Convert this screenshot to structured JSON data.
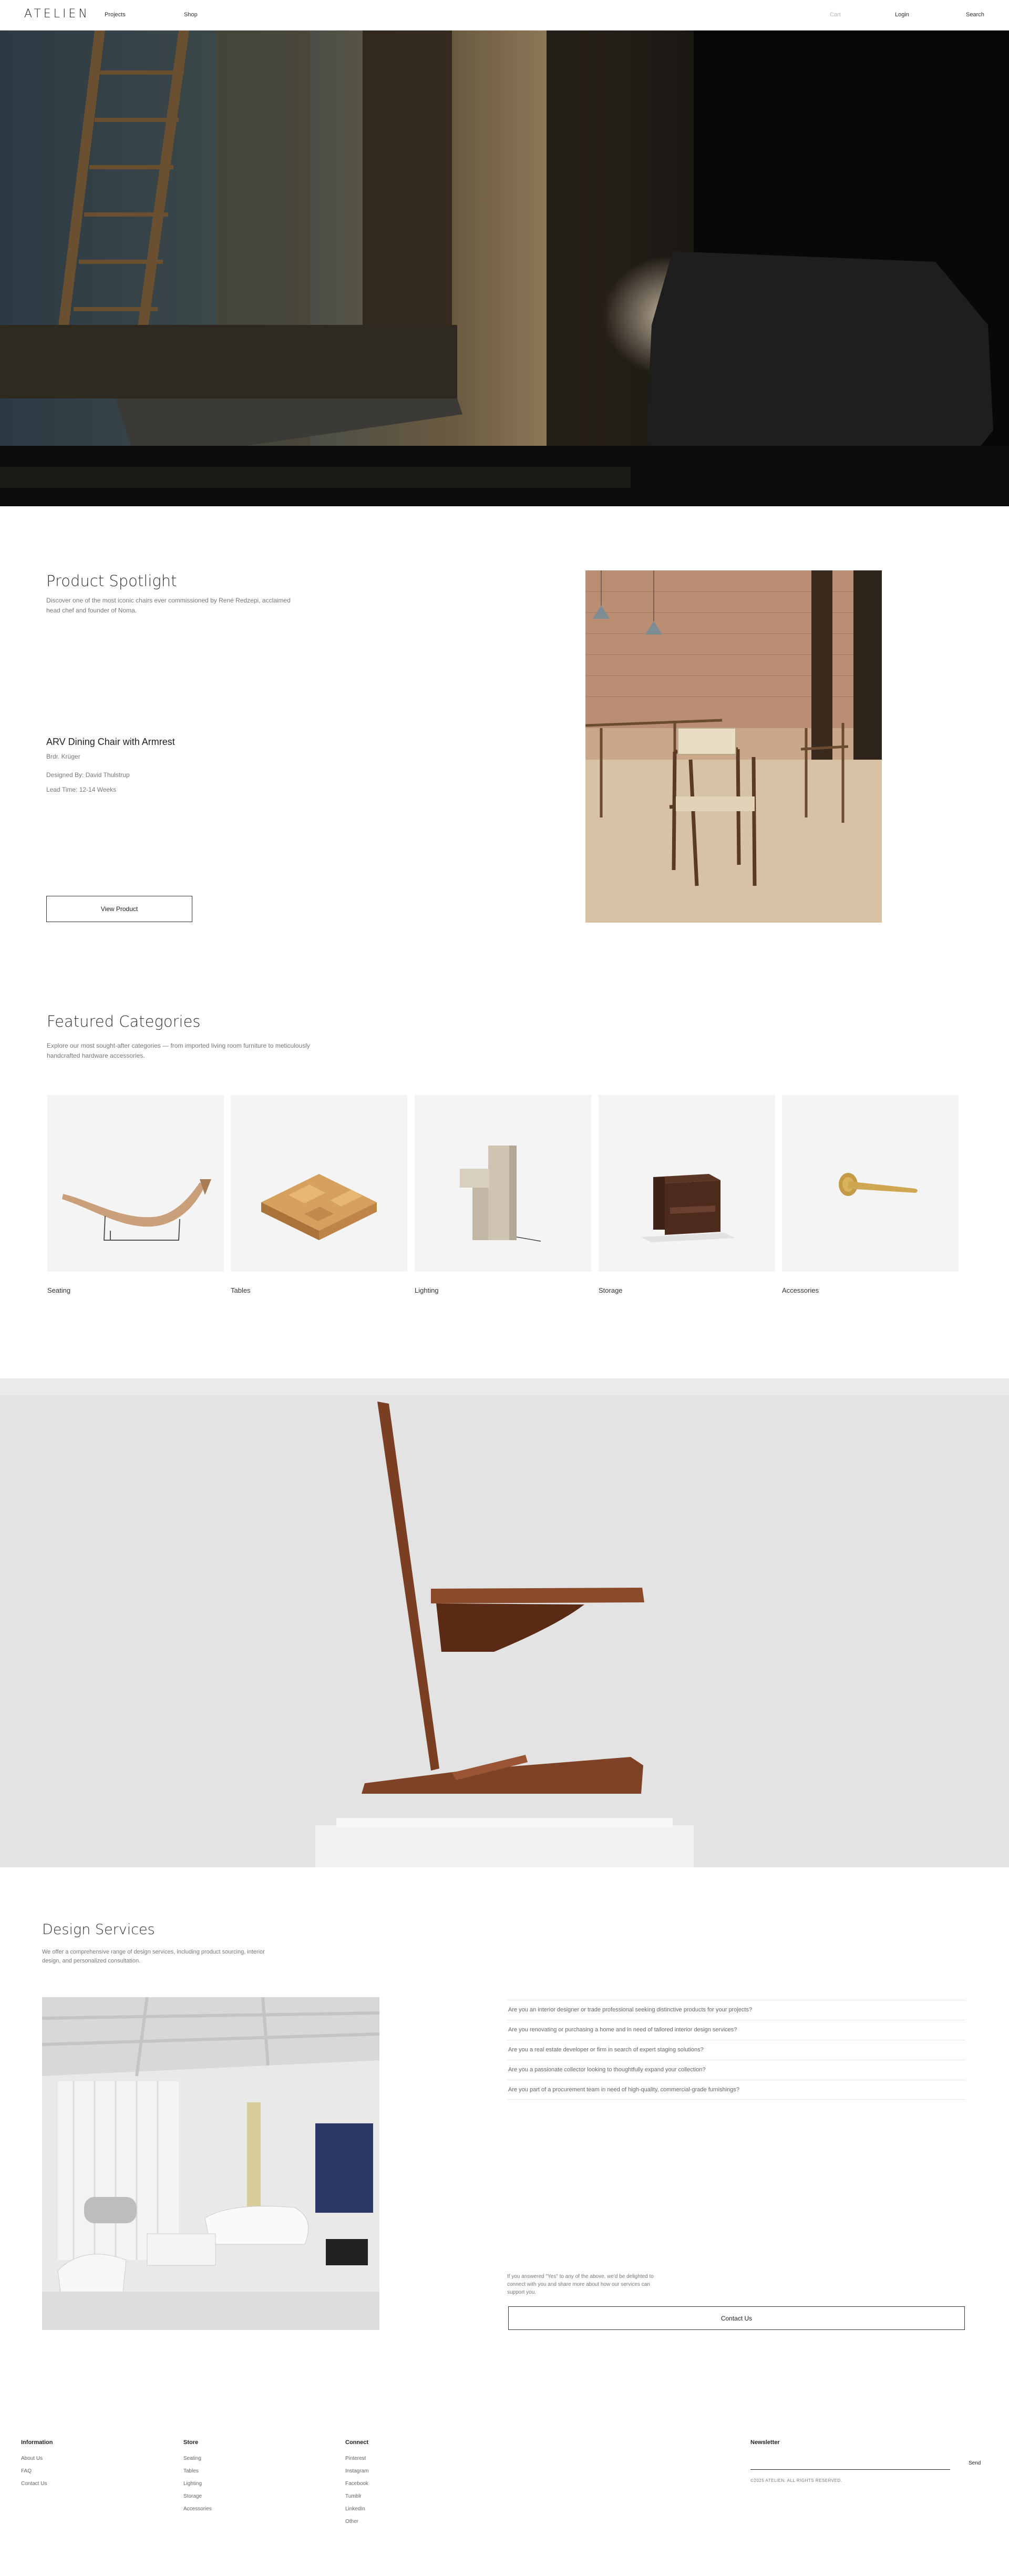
{
  "header": {
    "logo": "ATELIEN",
    "nav_projects": "Projects",
    "nav_shop": "Shop",
    "nav_cart": "Cart",
    "nav_login": "Login",
    "nav_search": "Search"
  },
  "spotlight": {
    "title": "Product Spotlight",
    "description": "Discover one of the most iconic chairs ever commissioned by René Redzepi, acclaimed head chef and founder of Noma.",
    "product_name": "ARV Dining Chair with Armrest",
    "brand": "Brdr. Krüger",
    "designer": "Designed By: David Thulstrup",
    "lead_time": "Lead Time: 12-14 Weeks",
    "button": "View Product"
  },
  "categories": {
    "title": "Featured Categories",
    "description": "Explore our most sought-after categories — from imported living room furniture to meticulously handcrafted hardware accessories.",
    "items": [
      {
        "label": "Seating",
        "icon": "lounge-chair-image"
      },
      {
        "label": "Tables",
        "icon": "table-image"
      },
      {
        "label": "Lighting",
        "icon": "lamp-image"
      },
      {
        "label": "Storage",
        "icon": "cabinet-image"
      },
      {
        "label": "Accessories",
        "icon": "door-handle-image"
      }
    ]
  },
  "services": {
    "title": "Design Services",
    "description": "We offer a comprehensive range of design services, including product sourcing, interior design, and personalized consultation.",
    "questions": [
      "Are you an interior designer or trade professional seeking distinctive products for your projects?",
      "Are you renovating or purchasing a home and in need of tailored interior design services?",
      "Are you a real estate developer or firm in search of expert staging solutions?",
      "Are you a passionate collector looking to thoughtfully expand your collection?",
      "Are you part of a procurement team in need of high-quality, commercial-grade furnishings?"
    ],
    "closing": "If you answered \"Yes\" to any of the above, we'd be delighted to connect with you and share more about how our services can support you.",
    "button": "Contact Us"
  },
  "footer": {
    "information": {
      "heading": "Information",
      "links": [
        "About Us",
        "FAQ",
        "Contact Us"
      ]
    },
    "store": {
      "heading": "Store",
      "links": [
        "Seating",
        "Tables",
        "Lighting",
        "Storage",
        "Accessories"
      ]
    },
    "connect": {
      "heading": "Connect",
      "links": [
        "Pinterest",
        "Instagram",
        "Facebook",
        "Tumblr",
        "LinkedIn",
        "Other"
      ]
    },
    "newsletter": {
      "heading": "Newsletter",
      "placeholder": "",
      "send": "Send",
      "copyright": "©2025 ATELIEN. ALL RIGHTS RESERVED."
    }
  },
  "colors": {
    "text": "#222222",
    "muted": "#777777",
    "tile_bg": "#f4f4f4",
    "wood": "#7a3e22"
  }
}
